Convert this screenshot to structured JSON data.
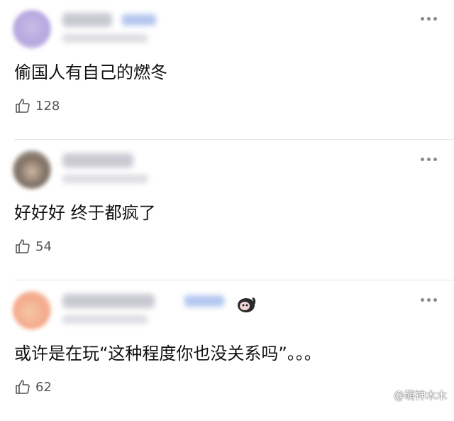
{
  "comments": [
    {
      "text": "偷国人有自己的燃冬",
      "likes": "128"
    },
    {
      "text": "好好好 终于都疯了",
      "likes": "54"
    },
    {
      "text": "或许是在玩“这种程度你也没关系吗”。。。",
      "likes": "62"
    }
  ],
  "watermark": {
    "label": "@萌神木木"
  },
  "icons": {
    "more": "more-dots-icon",
    "like": "thumbs-up-icon",
    "watermark": "weibo-logo-icon"
  }
}
